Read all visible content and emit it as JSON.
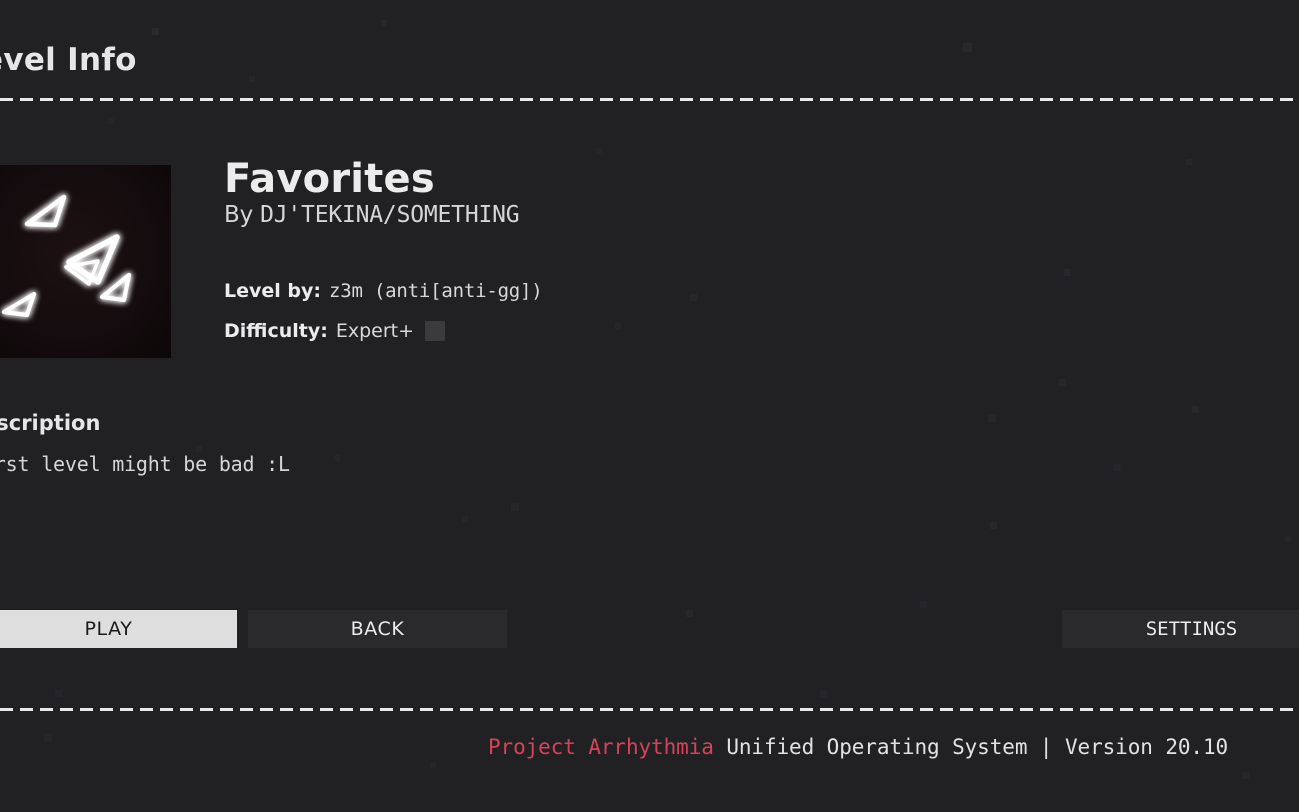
{
  "header": {
    "title": "evel Info",
    "full_title": "Level Info"
  },
  "level": {
    "name": "Favorites",
    "by_prefix": "By ",
    "artist": "DJ'TEKINA/SOMETHING",
    "level_by_label": "Level by:",
    "level_by_value": "z3m (anti[anti-gg])",
    "difficulty_label": "Difficulty:",
    "difficulty_value": "Expert+",
    "difficulty_color": "#3b3b3e",
    "thumbnail_icon": "triangles-glow-icon"
  },
  "description": {
    "heading": "escription",
    "full_heading": "Description",
    "text": "irst level might be bad :L",
    "full_text": "first level might be bad :L"
  },
  "buttons": {
    "play": "PLAY",
    "back": "BACK",
    "settings": "SETTINGS"
  },
  "footer": {
    "brand": "Project Arrhythmia",
    "rest": " Unified Operating System | Version 20.10"
  },
  "colors": {
    "background": "#212124",
    "text": "#e0e0e0",
    "accent": "#d64358",
    "play_button": "#dedede",
    "button": "#2a2a2d",
    "divider": "#e8e8e8"
  }
}
